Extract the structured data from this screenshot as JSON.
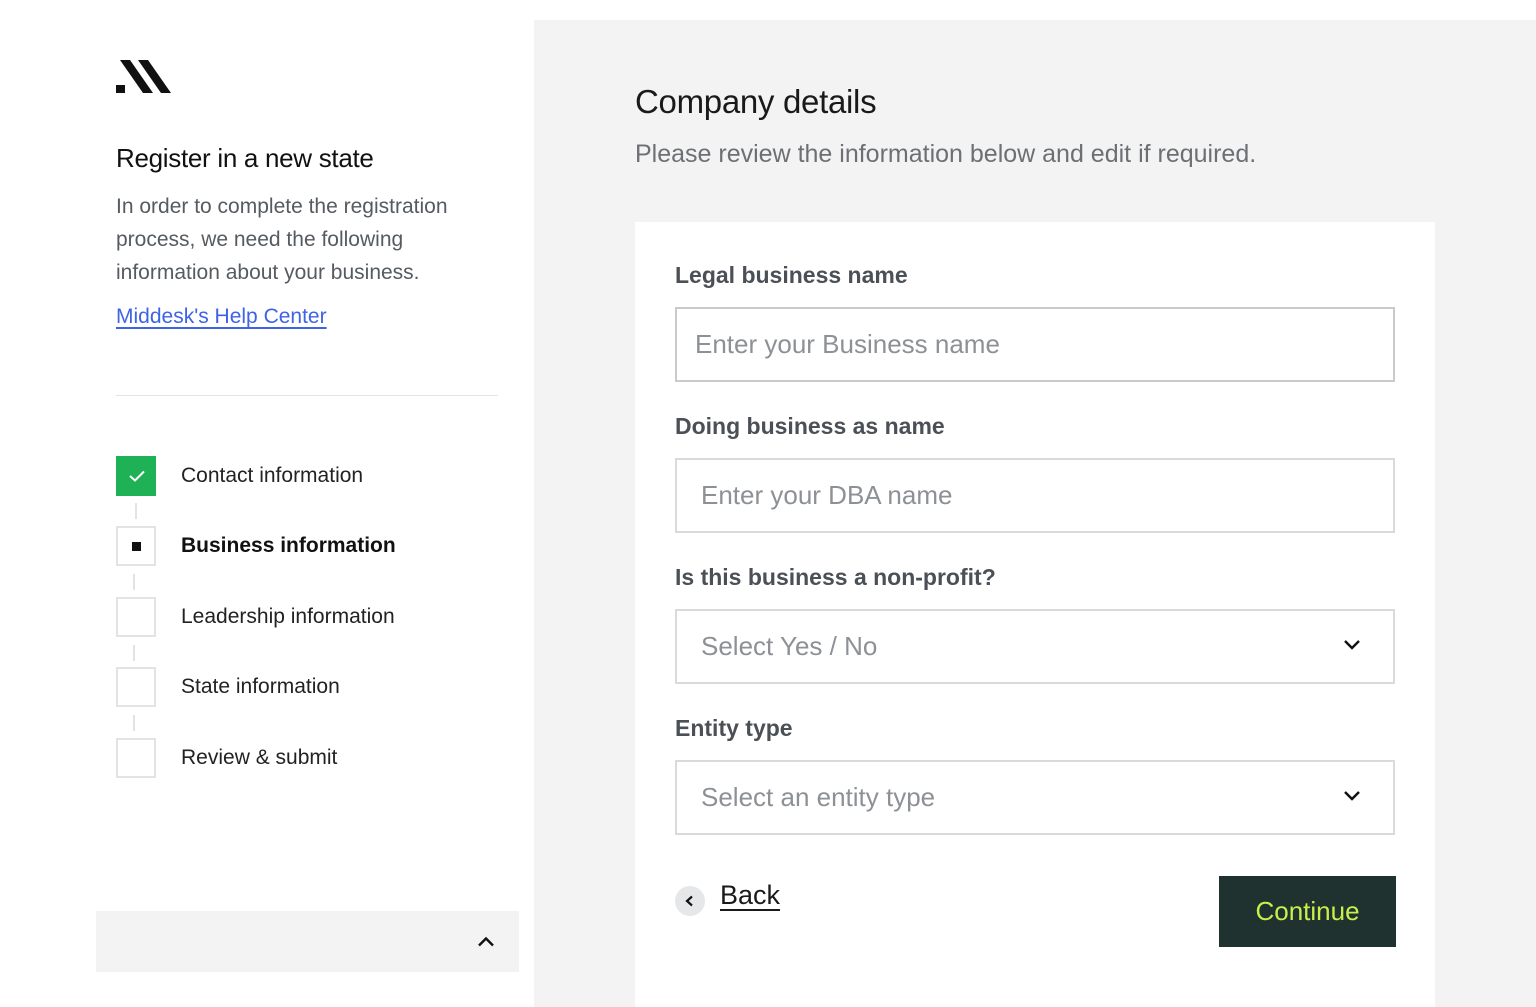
{
  "sidebar": {
    "logo_icon": "middesk-logo-icon",
    "title": "Register in a new state",
    "description": "In order to complete the registration process, we need the following information about your business.",
    "help_link": "Middesk's Help Center",
    "steps": [
      {
        "label": "Contact information",
        "status": "completed"
      },
      {
        "label": "Business information",
        "status": "current"
      },
      {
        "label": "Leadership information",
        "status": "pending"
      },
      {
        "label": "State information",
        "status": "pending"
      },
      {
        "label": "Review & submit",
        "status": "pending"
      }
    ],
    "footer_icon": "chevron-up-icon"
  },
  "main": {
    "title": "Company details",
    "subtitle": "Please review the information below and edit if required.",
    "fields": {
      "legal_name": {
        "label": "Legal business name",
        "placeholder": "Enter your Business name",
        "value": ""
      },
      "dba_name": {
        "label": "Doing business as name",
        "placeholder": "Enter your DBA name",
        "value": ""
      },
      "non_profit": {
        "label": "Is this business a non-profit?",
        "placeholder": "Select Yes / No",
        "value": ""
      },
      "entity_type": {
        "label": "Entity type",
        "placeholder": "Select an entity type",
        "value": ""
      }
    },
    "back_label": "Back",
    "continue_label": "Continue"
  },
  "colors": {
    "accent_link": "#3f63e6",
    "step_done": "#1fb156",
    "continue_bg": "#1f3230",
    "continue_text": "#c8ef4a"
  }
}
